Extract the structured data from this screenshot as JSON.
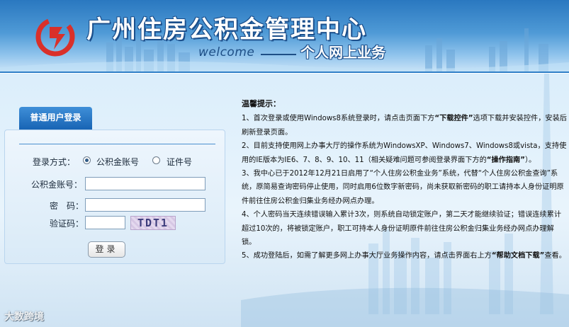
{
  "header": {
    "site_title": "广州住房公积金管理中心",
    "welcome": "welcome",
    "subtitle": "个人网上业务"
  },
  "login": {
    "tab_label": "普通用户登录",
    "login_method_label": "登录方式：",
    "option_account": "公积金账号",
    "option_id": "证件号",
    "selected_option": "公积金账号",
    "account_label": "公积金账号：",
    "account_value": "",
    "password_label": "密　码：",
    "password_value": "",
    "captcha_label": "验证码：",
    "captcha_value": "",
    "captcha_image_text": "TDT1",
    "submit_label": "登录"
  },
  "notice": {
    "title": "温馨提示：",
    "item1": {
      "pre": "1、首次登录或使用Windows8系统登录时，请点击页面下方",
      "bold": "“下载控件”",
      "post": "选项下载并安装控件，安装后刷新登录页面。"
    },
    "item2": {
      "pre": "2、目前支持使用网上办事大厅的操作系统为WindowsXP、Windows7、Windows8或vista，支持使用的IE版本为IE6、7、8、9、10、11（相关疑难问题可参阅登录界面下方的",
      "bold": "“操作指南”",
      "post": "）。"
    },
    "item3": "3、我中心已于2012年12月21日启用了“个人住房公积金业务”系统，代替“个人住房公积金查询”系统，原简易查询密码停止使用，同时启用6位数字新密码，尚未获取新密码的职工请持本人身份证明原件前往住房公积金归集业务经办网点办理。",
    "item4": "4、个人密码当天连续错误输入累计3次，则系统自动锁定账户，第二天才能继续验证；错误连续累计超过10次的，将被锁定账户，职工可持本人身份证明原件前往住房公积金归集业务经办网点办理解锁。",
    "item5": {
      "pre": "5、成功登陆后，如需了解更多网上办事大厅业务操作内容，请点击界面右上方",
      "bold": "“帮助文档下载”",
      "post": "查看。"
    }
  },
  "watermark": "大数跨境",
  "colors": {
    "header_blue": "#2a78c0",
    "tab_blue": "#1864b4",
    "page_background": "#e9f4fc"
  }
}
